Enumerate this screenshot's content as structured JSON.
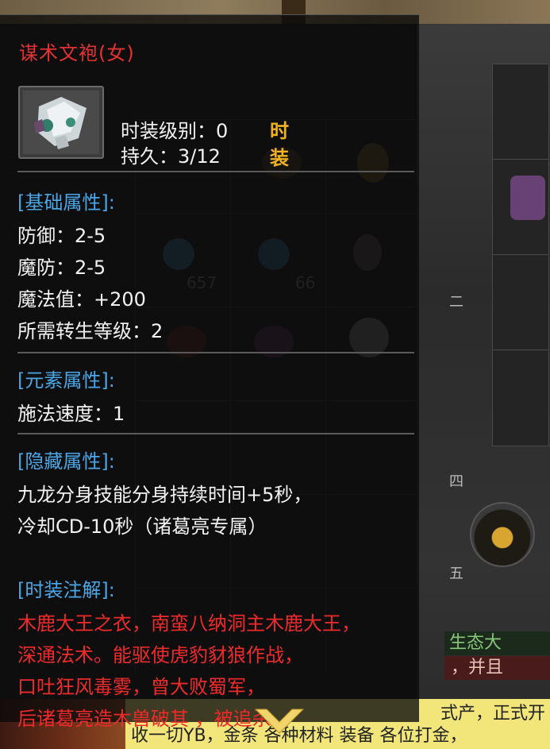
{
  "background": {
    "inventory_counts": [
      "657",
      "66"
    ],
    "rail_characters": [
      "二",
      "四",
      "五"
    ],
    "side_panel": {
      "green_label": "生态大",
      "red_label": "，并且"
    },
    "marquee_lines": [
      "式产，正式开",
      "收一切YB，金条 各种材料 装备 各位打金，"
    ]
  },
  "tooltip": {
    "item_name": "谋术文袍(女)",
    "icon": "robe-item-icon",
    "fashion_level": "时装级别：0",
    "durability": "持久：3/12",
    "badge_chars": [
      "时",
      "装"
    ],
    "sections": {
      "base": {
        "header": "[基础属性]:",
        "lines": [
          "防御：2-5",
          "魔防：2-5",
          "魔法值：+200",
          "所需转生等级：2"
        ]
      },
      "element": {
        "header": "[元素属性]:",
        "lines": [
          "施法速度：1"
        ]
      },
      "hidden": {
        "header": "[隐藏属性]:",
        "lines": [
          "九龙分身技能分身持续时间+5秒，",
          "冷却CD-10秒（诸葛亮专属）"
        ]
      },
      "notes": {
        "header": "[时装注解]:",
        "lines": [
          "木鹿大王之衣，南蛮八纳洞主木鹿大王，",
          "深通法术。能驱使虎豹豺狼作战，",
          "口吐狂风毒雾，曾大败蜀军，",
          "后诸葛亮造木兽破其        ，被追杀。"
        ]
      }
    },
    "scroll_icon": "chevron-down-icon"
  },
  "colors": {
    "title": "#e43232",
    "section_header": "#4aa6e6",
    "text": "#f2f2f2",
    "lore": "#ef2a2a",
    "badge": "#f0b31f"
  }
}
